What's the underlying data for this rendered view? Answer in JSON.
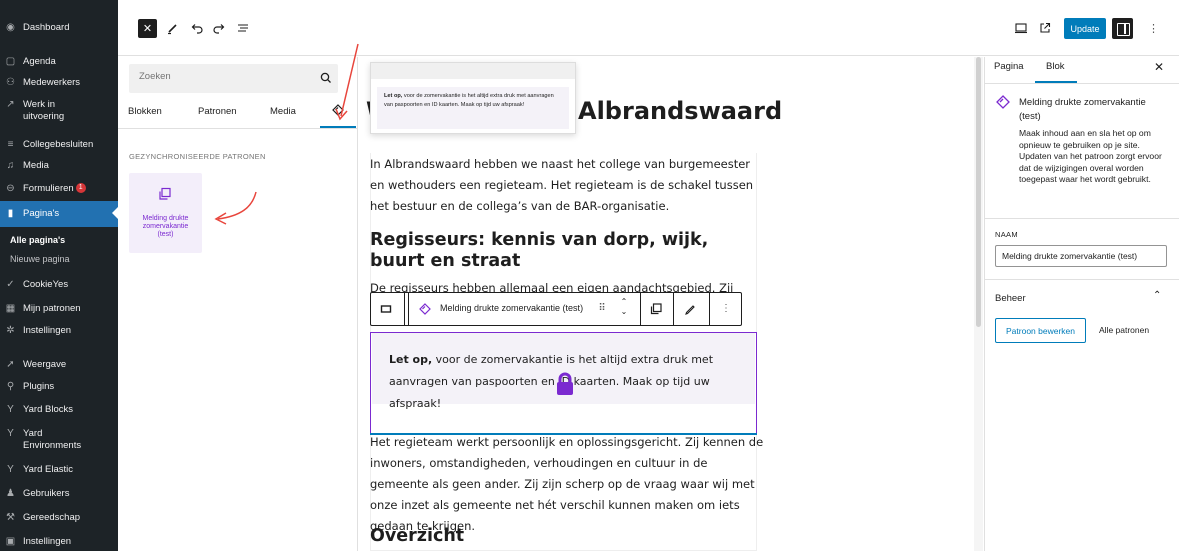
{
  "admin_menu": {
    "dashboard": "Dashboard",
    "agenda": "Agenda",
    "medewerkers": "Medewerkers",
    "werk_in_uitvoering_1": "Werk in",
    "werk_in_uitvoering_2": "uitvoering",
    "collegebesluiten": "Collegebesluiten",
    "media": "Media",
    "formulieren": "Formulieren",
    "formulieren_badge": "1",
    "paginas": "Pagina's",
    "alle_paginas": "Alle pagina's",
    "nieuwe_pagina": "Nieuwe pagina",
    "cookieyes": "CookieYes",
    "mijn_patronen": "Mijn patronen",
    "instellingen_1": "Instellingen",
    "weergave": "Weergave",
    "plugins": "Plugins",
    "yard_blocks": "Yard Blocks",
    "yard_environments_1": "Yard",
    "yard_environments_2": "Environments",
    "yard_elastic": "Yard Elastic",
    "gebruikers": "Gebruikers",
    "gereedschap": "Gereedschap",
    "instellingen_2": "Instellingen"
  },
  "toolbar": {
    "update_label": "Update"
  },
  "inserter": {
    "search_placeholder": "Zoeken",
    "tabs": [
      "Blokken",
      "Patronen",
      "Media"
    ],
    "section_heading": "GEZYNCHRONISEERDE PATRONEN",
    "pattern_label_1": "Melding drukte",
    "pattern_label_2": "zomervakantie",
    "pattern_label_3": "(test)"
  },
  "canvas": {
    "heading_left": "W",
    "heading_right": "Albrandswaard",
    "preview_bold": "Let op,",
    "preview_text": " voor de zomervakantie is het altijd extra druk met aanvragen van paspoorten en ID kaarten. Maak op tijd uw afspraak!",
    "para1": "In Albrandswaard hebben we naast het college van burgemeester en wethouders een regieteam. Het regieteam is de schakel tussen het bestuur en de collega’s van de BAR-organisatie.",
    "heading2": "Regisseurs: kennis van dorp, wijk, buurt en straat",
    "para2_cut": "De regisseurs hebben allemaal een eigen aandachtsgebied. Zij houden zich",
    "block_toolbar_label": "Melding drukte zomervakantie (test)",
    "synced_bold": "Let op,",
    "synced_text": " voor de zomervakantie is het altijd extra druk met aanvragen van paspoorten en ID kaarten. Maak op tijd uw afspraak!",
    "para3": "Het regieteam werkt persoonlijk en oplossingsgericht. Zij kennen de inwoners, omstandigheden, verhoudingen en cultuur in de gemeente als geen ander. Zij zijn scherp op de vraag waar wij met onze inzet als gemeente net hét verschil kunnen maken om iets gedaan te krijgen.",
    "heading3": "Overzicht"
  },
  "settings": {
    "tab_page": "Pagina",
    "tab_block": "Blok",
    "block_title": "Melding drukte zomervakantie (test)",
    "block_desc": "Maak inhoud aan en sla het op om opnieuw te gebruiken op je site. Updaten van het patroon zorgt ervoor dat de wijzigingen overal worden toegepast waar het wordt gebruikt.",
    "name_label": "NAAM",
    "name_value": "Melding drukte zomervakantie (test)",
    "beheer_label": "Beheer",
    "edit_pattern_label": "Patroon bewerken",
    "all_patterns_label": "Alle patronen"
  },
  "colors": {
    "accent": "#007cba",
    "pattern_purple": "#7b2ad0",
    "admin_bg": "#1d2327",
    "admin_active": "#2271b1",
    "annotation_red": "#e8453c"
  }
}
